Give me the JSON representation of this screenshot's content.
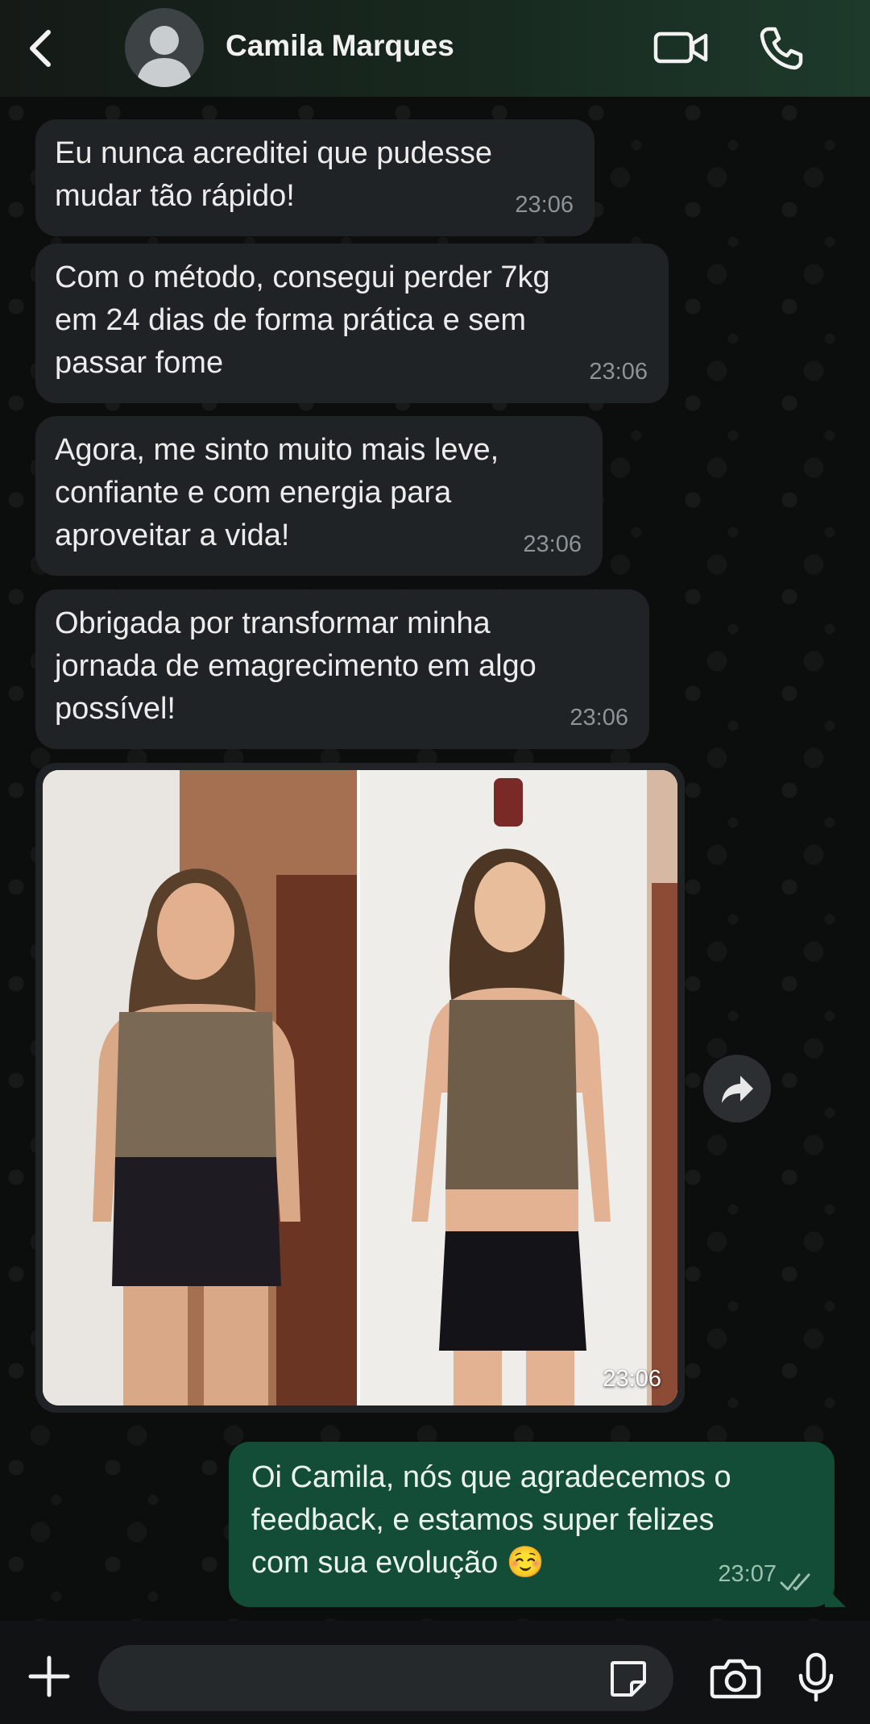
{
  "header": {
    "contact_name": "Camila Marques",
    "icons": [
      "back-icon",
      "avatar",
      "video-call-icon",
      "phone-icon"
    ],
    "gradient_colors": [
      "#151a17",
      "#1d3a2b"
    ]
  },
  "messages": [
    {
      "direction": "incoming",
      "text": "Eu nunca acreditei que pudesse\nmudar tão rápido!",
      "time": "23:06"
    },
    {
      "direction": "incoming",
      "text": "Com o método, consegui perder 7kg\nem 24 dias de forma prática e sem\npassar fome",
      "time": "23:06"
    },
    {
      "direction": "incoming",
      "text": "Agora, me sinto muito mais leve,\nconfiante e com energia para\naproveitar a vida!",
      "time": "23:06"
    },
    {
      "direction": "incoming",
      "text": "Obrigada por transformar minha\njornada de emagrecimento em algo\npossível!",
      "time": "23:06"
    },
    {
      "direction": "incoming",
      "type": "image",
      "image_description": "before-after-photo",
      "time": "23:06"
    },
    {
      "direction": "outgoing",
      "text": "Oi Camila, nós que agradecemos o\nfeedback, e estamos super felizes\ncom sua evolução ☺️",
      "time": "23:07",
      "status": "read"
    }
  ],
  "composer": {
    "placeholder": "",
    "icons": [
      "plus-icon",
      "sticker-icon",
      "camera-icon",
      "mic-icon"
    ]
  },
  "colors": {
    "incoming_bubble": "#1f2325",
    "outgoing_bubble": "#134d37",
    "background": "#0c0d0d"
  }
}
